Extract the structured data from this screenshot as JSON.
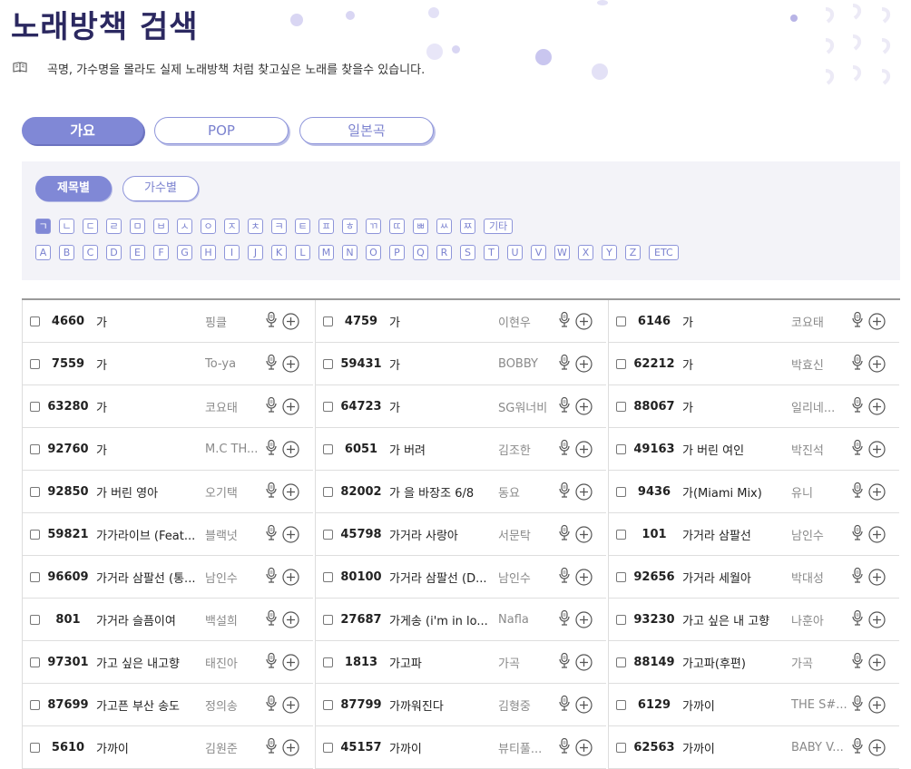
{
  "page": {
    "title": "노래방책 검색",
    "subtitle": "곡명, 가수명을 몰라도 실제 노래방책 처럼 찾고싶은 노래를 찾을수 있습니다.",
    "book_icon": "book-icon"
  },
  "main_tabs": [
    "가요",
    "POP",
    "일본곡"
  ],
  "sub_tabs": [
    "제목별",
    "가수별"
  ],
  "korean_initials": [
    "ㄱ",
    "ㄴ",
    "ㄷ",
    "ㄹ",
    "ㅁ",
    "ㅂ",
    "ㅅ",
    "ㅇ",
    "ㅈ",
    "ㅊ",
    "ㅋ",
    "ㅌ",
    "ㅍ",
    "ㅎ",
    "ㄲ",
    "ㄸ",
    "ㅃ",
    "ㅆ",
    "ㅉ",
    "기타"
  ],
  "latin_initials": [
    "A",
    "B",
    "C",
    "D",
    "E",
    "F",
    "G",
    "H",
    "I",
    "J",
    "K",
    "L",
    "M",
    "N",
    "O",
    "P",
    "Q",
    "R",
    "S",
    "T",
    "U",
    "V",
    "W",
    "X",
    "Y",
    "Z",
    "ETC"
  ],
  "colors": {
    "accent": "#8088d6",
    "title": "#2b2860",
    "panel": "#f3f3f8"
  },
  "results": [
    [
      {
        "num": "4660",
        "title": "가",
        "artist": "핑클"
      },
      {
        "num": "7559",
        "title": "가",
        "artist": "To-ya"
      },
      {
        "num": "63280",
        "title": "가",
        "artist": "코요태"
      },
      {
        "num": "92760",
        "title": "가",
        "artist": "M.C TH..."
      },
      {
        "num": "92850",
        "title": "가 버린 영아",
        "artist": "오기택"
      },
      {
        "num": "59821",
        "title": "가가라이브 (Feat...",
        "artist": "블랙넛"
      },
      {
        "num": "96609",
        "title": "가거라 삼팔선 (통...",
        "artist": "남인수"
      },
      {
        "num": "801",
        "title": "가거라 슬픔이여",
        "artist": "백설희"
      },
      {
        "num": "97301",
        "title": "가고 싶은 내고향",
        "artist": "태진아"
      },
      {
        "num": "87699",
        "title": "가고픈 부산 송도",
        "artist": "정의송"
      },
      {
        "num": "5610",
        "title": "가까이",
        "artist": "김원준"
      }
    ],
    [
      {
        "num": "4759",
        "title": "가",
        "artist": "이현우"
      },
      {
        "num": "59431",
        "title": "가",
        "artist": "BOBBY"
      },
      {
        "num": "64723",
        "title": "가",
        "artist": "SG워너비"
      },
      {
        "num": "6051",
        "title": "가 버려",
        "artist": "김조한"
      },
      {
        "num": "82002",
        "title": "가 을 바장조 6/8",
        "artist": "동요"
      },
      {
        "num": "45798",
        "title": "가거라 사랑아",
        "artist": "서문탁"
      },
      {
        "num": "80100",
        "title": "가거라 삼팔선 (D...",
        "artist": "남인수"
      },
      {
        "num": "27687",
        "title": "가게송 (i'm in lo...",
        "artist": "Nafla"
      },
      {
        "num": "1813",
        "title": "가고파",
        "artist": "가곡"
      },
      {
        "num": "87799",
        "title": "가까워진다",
        "artist": "김형중"
      },
      {
        "num": "45157",
        "title": "가까이",
        "artist": "뷰티풀..."
      }
    ],
    [
      {
        "num": "6146",
        "title": "가",
        "artist": "코요태"
      },
      {
        "num": "62212",
        "title": "가",
        "artist": "박효신"
      },
      {
        "num": "88067",
        "title": "가",
        "artist": "일리네..."
      },
      {
        "num": "49163",
        "title": "가 버린 여인",
        "artist": "박진석"
      },
      {
        "num": "9436",
        "title": "가(Miami Mix)",
        "artist": "유니"
      },
      {
        "num": "101",
        "title": "가거라 삼팔선",
        "artist": "남인수"
      },
      {
        "num": "92656",
        "title": "가거라 세월아",
        "artist": "박대성"
      },
      {
        "num": "93230",
        "title": "가고 싶은 내 고향",
        "artist": "나훈아"
      },
      {
        "num": "88149",
        "title": "가고파(후편)",
        "artist": "가곡"
      },
      {
        "num": "6129",
        "title": "가까이",
        "artist": "THE S#..."
      },
      {
        "num": "62563",
        "title": "가까이",
        "artist": "BABY V..."
      }
    ]
  ]
}
